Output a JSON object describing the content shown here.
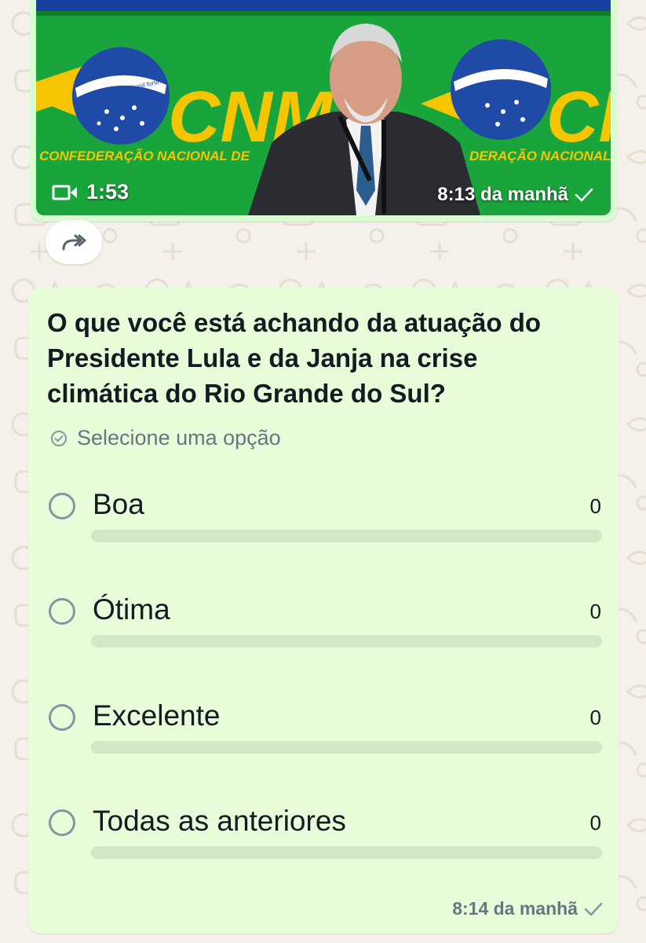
{
  "video_message": {
    "duration": "1:53",
    "time": "8:13 da manhã",
    "banner_text_left": "CONFEDERAÇÃO NACIONAL DE",
    "banner_text_right": "DERAÇÃO NACIONAL",
    "logo_text": "CNM",
    "logo_text_right": "CN",
    "emblem_text": "Município forte, Brasil forte.",
    "status_icon": "single-check-icon"
  },
  "forward": {
    "icon": "forward-icon"
  },
  "poll": {
    "question": "O que você está achando da atuação do Presidente Lula e da Janja na crise climática do Rio Grande do Sul?",
    "hint": "Selecione uma opção",
    "options": [
      {
        "label": "Boa",
        "votes": "0",
        "fraction": 0
      },
      {
        "label": "Ótima",
        "votes": "0",
        "fraction": 0
      },
      {
        "label": "Excelente",
        "votes": "0",
        "fraction": 0
      },
      {
        "label": "Todas as anteriores",
        "votes": "0",
        "fraction": 0
      }
    ],
    "time": "8:14 da manhã",
    "status_icon": "single-check-icon"
  },
  "colors": {
    "bubble_background": "#e7fcd8",
    "video_bubble_background": "#d9fdd3",
    "chat_wallpaper": "#f5f1ea",
    "bar_track": "#d2e6c8",
    "radio_border": "#8696a0",
    "secondary_text": "#667781",
    "video_backdrop": "#17a33b",
    "banner_yellow": "#f6c500",
    "emblem_blue": "#1f4aa8"
  }
}
